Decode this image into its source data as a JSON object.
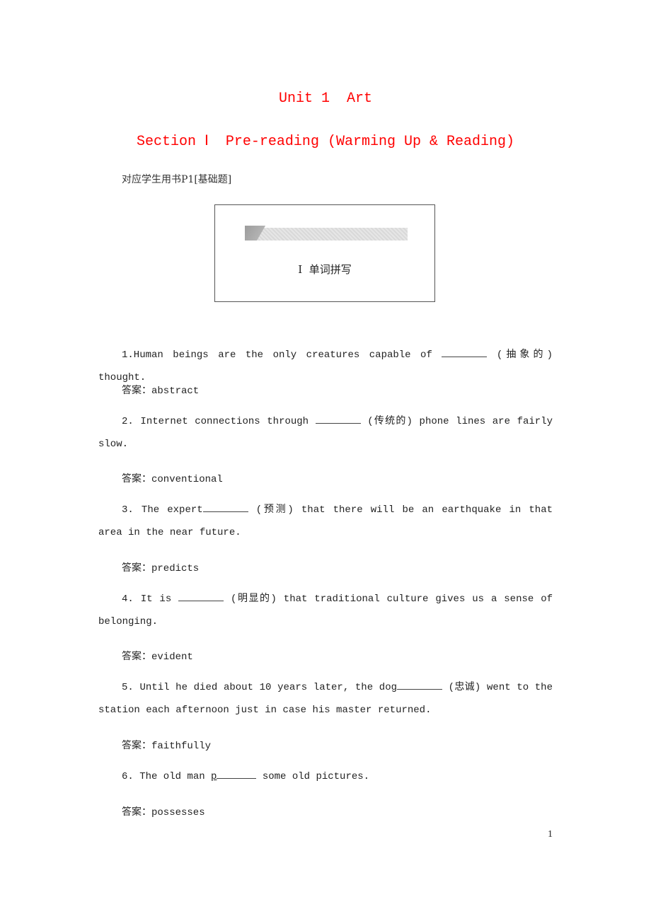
{
  "header": {
    "unit_title": "Unit 1  Art",
    "section_title": "Section Ⅰ  Pre-reading (Warming Up & Reading)"
  },
  "reference": "对应学生用书P1[基础题]",
  "section_box": {
    "label": "Ⅰ  单词拼写"
  },
  "questions": [
    {
      "before": "1.Human beings are the only creatures capable of ",
      "after": " (抽象的) thought.",
      "answer_label": "答案：",
      "answer": "abstract"
    },
    {
      "before": "2. Internet connections through ",
      "after": " (传统的) phone lines are fairly slow.",
      "answer_label": "答案：",
      "answer": "conventional"
    },
    {
      "before": "3. The expert",
      "after": " (预测) that there will be an earthquake in that area in the near future.",
      "answer_label": "答案：",
      "answer": "predicts"
    },
    {
      "before": "4. It is ",
      "after": " (明显的) that traditional culture gives us a sense of belonging.",
      "answer_label": "答案：",
      "answer": "evident"
    },
    {
      "before": "5. Until he died about 10 years later, the dog",
      "after": " (忠诚) went to the station each afternoon just in case his master returned.",
      "answer_label": "答案：",
      "answer": "faithfully"
    },
    {
      "before": "6. The old man ",
      "hint": "p",
      "after": " some old pictures.",
      "answer_label": "答案：",
      "answer": "possesses"
    }
  ],
  "page_number": "1"
}
